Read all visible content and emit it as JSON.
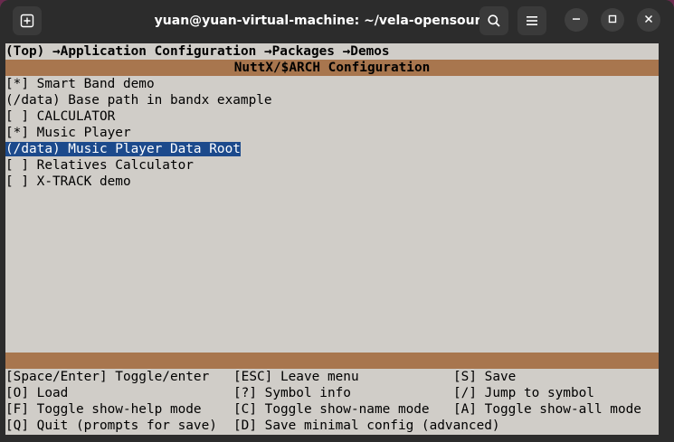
{
  "window": {
    "title": "yuan@yuan-virtual-machine: ~/vela-opensource",
    "controls": {
      "new_tab_icon": "new-tab-icon",
      "search_icon": "search-icon",
      "menu_icon": "hamburger-menu-icon",
      "minimize_icon": "minimize-icon",
      "maximize_icon": "maximize-icon",
      "close_icon": "close-icon"
    }
  },
  "menuconfig": {
    "breadcrumb": {
      "top": "(Top)",
      "arrow": "→",
      "items": [
        "Application Configuration",
        "Packages",
        "Demos"
      ]
    },
    "header": "NuttX/$ARCH Configuration",
    "items": [
      {
        "label": "[*] Smart Band demo",
        "selected": false
      },
      {
        "label": "(/data) Base path in bandx example",
        "selected": false
      },
      {
        "label": "[ ] CALCULATOR",
        "selected": false
      },
      {
        "label": "[*] Music Player",
        "selected": false
      },
      {
        "label": "(/data) Music Player Data Root",
        "selected": true
      },
      {
        "label": "[ ] Relatives Calculator",
        "selected": false
      },
      {
        "label": "[ ] X-TRACK demo",
        "selected": false
      }
    ],
    "help": [
      [
        "[Space/Enter] Toggle/enter",
        "[ESC] Leave menu",
        "[S] Save"
      ],
      [
        "[O] Load",
        "[?] Symbol info",
        "[/] Jump to symbol"
      ],
      [
        "[F] Toggle show-help mode",
        "[C] Toggle show-name mode",
        "[A] Toggle show-all mode"
      ],
      [
        "[Q] Quit (prompts for save)",
        "[D] Save minimal config (advanced)",
        ""
      ]
    ]
  },
  "colors": {
    "terminal_bg": "#d0cdc8",
    "bar": "#a8764e",
    "selection": "#1c4a8c",
    "titlebar": "#2c2c2c"
  }
}
